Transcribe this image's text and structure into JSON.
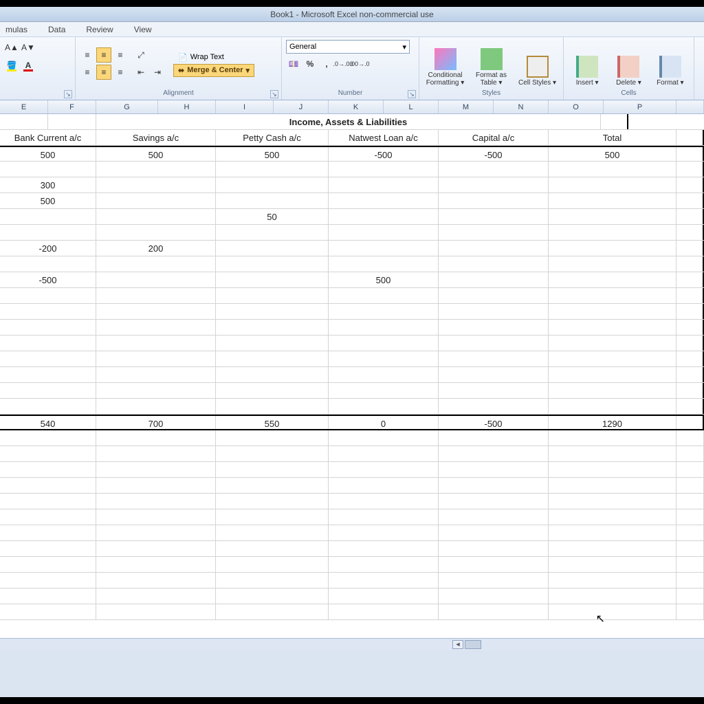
{
  "title": "Book1 - Microsoft Excel non-commercial use",
  "menu": {
    "formulas": "mulas",
    "data": "Data",
    "review": "Review",
    "view": "View"
  },
  "ribbon": {
    "font_label": "",
    "alignment_label": "Alignment",
    "number_label": "Number",
    "styles_label": "Styles",
    "cells_label": "Cells",
    "wrap": "Wrap Text",
    "merge": "Merge & Center",
    "number_format": "General",
    "cond_fmt": "Conditional Formatting",
    "fmt_table": "Format as Table",
    "cell_styles": "Cell Styles",
    "insert": "Insert",
    "delete": "Delete",
    "format": "Format"
  },
  "columns": [
    "E",
    "F",
    "G",
    "H",
    "I",
    "J",
    "K",
    "L",
    "M",
    "N",
    "O",
    "P",
    ""
  ],
  "sheet": {
    "title": "Income, Assets & Liabilities",
    "headers": {
      "bank": "Bank Current a/c",
      "savings": "Savings a/c",
      "petty": "Petty Cash a/c",
      "natwest": "Natwest Loan a/c",
      "capital": "Capital a/c",
      "total": "Total"
    }
  },
  "chart_data": {
    "type": "table",
    "title": "Income, Assets & Liabilities",
    "columns": [
      "Bank Current a/c",
      "Savings a/c",
      "Petty Cash a/c",
      "Natwest Loan a/c",
      "Capital a/c",
      "Total"
    ],
    "rows": [
      {
        "bank": "500",
        "savings": "500",
        "petty": "500",
        "natwest": "-500",
        "capital": "-500",
        "total": "500"
      },
      {
        "bank": "",
        "savings": "",
        "petty": "",
        "natwest": "",
        "capital": "",
        "total": ""
      },
      {
        "bank": "300",
        "savings": "",
        "petty": "",
        "natwest": "",
        "capital": "",
        "total": ""
      },
      {
        "bank": "500",
        "savings": "",
        "petty": "",
        "natwest": "",
        "capital": "",
        "total": ""
      },
      {
        "bank": "",
        "savings": "",
        "petty": "50",
        "natwest": "",
        "capital": "",
        "total": ""
      },
      {
        "bank": "",
        "savings": "",
        "petty": "",
        "natwest": "",
        "capital": "",
        "total": ""
      },
      {
        "bank": "-200",
        "savings": "200",
        "petty": "",
        "natwest": "",
        "capital": "",
        "total": ""
      },
      {
        "bank": "",
        "savings": "",
        "petty": "",
        "natwest": "",
        "capital": "",
        "total": ""
      },
      {
        "bank": "-500",
        "savings": "",
        "petty": "",
        "natwest": "500",
        "capital": "",
        "total": ""
      }
    ],
    "totals": {
      "bank": "540",
      "savings": "700",
      "petty": "550",
      "natwest": "0",
      "capital": "-500",
      "total": "1290"
    }
  }
}
